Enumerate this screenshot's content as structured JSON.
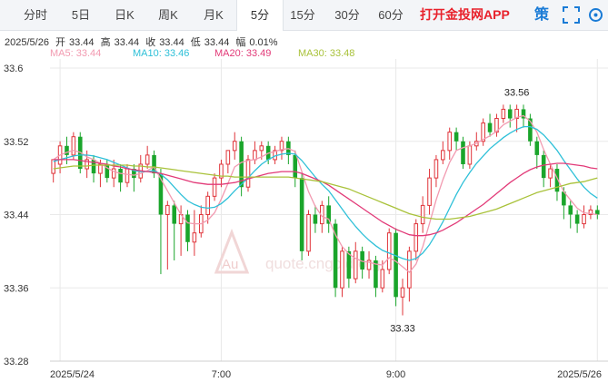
{
  "tabs": [
    {
      "label": "分时",
      "active": false
    },
    {
      "label": "5日",
      "active": false
    },
    {
      "label": "日K",
      "active": false
    },
    {
      "label": "周K",
      "active": false
    },
    {
      "label": "月K",
      "active": false
    },
    {
      "label": "5分",
      "active": true
    },
    {
      "label": "15分",
      "active": false
    },
    {
      "label": "30分",
      "active": false
    },
    {
      "label": "60分",
      "active": false
    }
  ],
  "app_title": "打开金投网APP",
  "strategy_label": "策",
  "icons": {
    "fullscreen": "fullscreen-icon",
    "settings": "settings-icon"
  },
  "quote": {
    "date": "2025/5/26",
    "open_label": "开",
    "open": "33.44",
    "high_label": "高",
    "high": "33.44",
    "close_label": "收",
    "close": "33.44",
    "low_label": "低",
    "low": "33.44",
    "change_label": "幅",
    "change": "0.01%"
  },
  "ma": {
    "ma5": "MA5: 33.44",
    "ma10": "MA10: 33.46",
    "ma20": "MA20: 33.49",
    "ma30": "MA30: 33.48"
  },
  "watermark": {
    "mark": "Au",
    "text": "quote.cngold.org"
  },
  "colors": {
    "up": "#e0343a",
    "down": "#1aa52b",
    "ma5": "#f29ab0",
    "ma10": "#2ec0d8",
    "ma20": "#e23a78",
    "ma30": "#a9c23a",
    "accent": "#e8212b",
    "link": "#1a7bd6",
    "grid": "#e9e9e9"
  },
  "chart_data": {
    "type": "candlestick",
    "ylim": [
      33.28,
      33.6
    ],
    "yticks": [
      "33.6",
      "33.52",
      "33.44",
      "33.36",
      "33.28"
    ],
    "xtick_labels": [
      "2025/5/24",
      "7:00",
      "9:00",
      "2025/5/26"
    ],
    "xtick_index": [
      1,
      25,
      51,
      81
    ],
    "annotations": [
      {
        "text": "33.56",
        "index": 69,
        "value": 33.56
      },
      {
        "text": "33.33",
        "index": 52,
        "value": 33.33
      }
    ],
    "candles": [
      [
        33.485,
        33.5,
        33.495,
        33.475
      ],
      [
        33.495,
        33.515,
        33.52,
        33.485
      ],
      [
        33.515,
        33.505,
        33.525,
        33.495
      ],
      [
        33.505,
        33.525,
        33.53,
        33.5
      ],
      [
        33.525,
        33.49,
        33.53,
        33.485
      ],
      [
        33.49,
        33.5,
        33.51,
        33.48
      ],
      [
        33.5,
        33.485,
        33.505,
        33.475
      ],
      [
        33.485,
        33.495,
        33.5,
        33.47
      ],
      [
        33.495,
        33.48,
        33.5,
        33.475
      ],
      [
        33.48,
        33.49,
        33.5,
        33.47
      ],
      [
        33.49,
        33.475,
        33.495,
        33.465
      ],
      [
        33.475,
        33.49,
        33.495,
        33.47
      ],
      [
        33.49,
        33.48,
        33.495,
        33.465
      ],
      [
        33.48,
        33.495,
        33.505,
        33.475
      ],
      [
        33.495,
        33.505,
        33.515,
        33.49
      ],
      [
        33.505,
        33.485,
        33.51,
        33.48
      ],
      [
        33.485,
        33.44,
        33.49,
        33.375
      ],
      [
        33.44,
        33.45,
        33.455,
        33.38
      ],
      [
        33.45,
        33.43,
        33.455,
        33.39
      ],
      [
        33.43,
        33.44,
        33.45,
        33.395
      ],
      [
        33.44,
        33.41,
        33.445,
        33.4
      ],
      [
        33.41,
        33.42,
        33.445,
        33.395
      ],
      [
        33.42,
        33.44,
        33.45,
        33.415
      ],
      [
        33.44,
        33.46,
        33.465,
        33.43
      ],
      [
        33.46,
        33.48,
        33.485,
        33.455
      ],
      [
        33.48,
        33.495,
        33.5,
        33.47
      ],
      [
        33.495,
        33.51,
        33.51,
        33.485
      ],
      [
        33.51,
        33.52,
        33.53,
        33.5
      ],
      [
        33.52,
        33.47,
        33.525,
        33.46
      ],
      [
        33.47,
        33.5,
        33.505,
        33.465
      ],
      [
        33.5,
        33.51,
        33.52,
        33.495
      ],
      [
        33.51,
        33.515,
        33.52,
        33.5
      ],
      [
        33.515,
        33.5,
        33.52,
        33.495
      ],
      [
        33.5,
        33.51,
        33.515,
        33.495
      ],
      [
        33.51,
        33.52,
        33.525,
        33.5
      ],
      [
        33.52,
        33.505,
        33.525,
        33.495
      ],
      [
        33.505,
        33.48,
        33.51,
        33.47
      ],
      [
        33.48,
        33.4,
        33.485,
        33.39
      ],
      [
        33.4,
        33.44,
        33.445,
        33.395
      ],
      [
        33.44,
        33.43,
        33.45,
        33.42
      ],
      [
        33.43,
        33.45,
        33.455,
        33.42
      ],
      [
        33.45,
        33.43,
        33.46,
        33.42
      ],
      [
        33.43,
        33.36,
        33.435,
        33.35
      ],
      [
        33.36,
        33.4,
        33.405,
        33.35
      ],
      [
        33.4,
        33.37,
        33.405,
        33.36
      ],
      [
        33.37,
        33.4,
        33.41,
        33.365
      ],
      [
        33.4,
        33.38,
        33.405,
        33.37
      ],
      [
        33.38,
        33.39,
        33.4,
        33.37
      ],
      [
        33.39,
        33.36,
        33.395,
        33.35
      ],
      [
        33.36,
        33.38,
        33.39,
        33.355
      ],
      [
        33.38,
        33.42,
        33.425,
        33.375
      ],
      [
        33.42,
        33.35,
        33.425,
        33.34
      ],
      [
        33.35,
        33.36,
        33.37,
        33.33
      ],
      [
        33.36,
        33.4,
        33.405,
        33.345
      ],
      [
        33.4,
        33.43,
        33.435,
        33.39
      ],
      [
        33.43,
        33.45,
        33.46,
        33.42
      ],
      [
        33.45,
        33.48,
        33.49,
        33.44
      ],
      [
        33.48,
        33.5,
        33.505,
        33.47
      ],
      [
        33.5,
        33.51,
        33.52,
        33.495
      ],
      [
        33.51,
        33.53,
        33.535,
        33.5
      ],
      [
        33.53,
        33.52,
        33.535,
        33.51
      ],
      [
        33.52,
        33.495,
        33.525,
        33.49
      ],
      [
        33.495,
        33.515,
        33.52,
        33.49
      ],
      [
        33.515,
        33.52,
        33.53,
        33.51
      ],
      [
        33.52,
        33.54,
        33.545,
        33.515
      ],
      [
        33.54,
        33.53,
        33.55,
        33.525
      ],
      [
        33.53,
        33.545,
        33.55,
        33.525
      ],
      [
        33.545,
        33.555,
        33.56,
        33.54
      ],
      [
        33.555,
        33.545,
        33.56,
        33.535
      ],
      [
        33.545,
        33.555,
        33.56,
        33.53
      ],
      [
        33.555,
        33.545,
        33.56,
        33.535
      ],
      [
        33.545,
        33.52,
        33.55,
        33.515
      ],
      [
        33.52,
        33.505,
        33.525,
        33.49
      ],
      [
        33.505,
        33.48,
        33.51,
        33.47
      ],
      [
        33.48,
        33.49,
        33.495,
        33.47
      ],
      [
        33.49,
        33.465,
        33.495,
        33.455
      ],
      [
        33.465,
        33.45,
        33.47,
        33.435
      ],
      [
        33.45,
        33.44,
        33.455,
        33.425
      ],
      [
        33.44,
        33.43,
        33.445,
        33.42
      ],
      [
        33.43,
        33.44,
        33.45,
        33.425
      ],
      [
        33.44,
        33.445,
        33.45,
        33.435
      ],
      [
        33.445,
        33.44,
        33.45,
        33.435
      ]
    ],
    "ma_series": [
      {
        "key": "ma5",
        "values": [
          33.5,
          33.505,
          33.508,
          33.51,
          33.508,
          33.503,
          33.5,
          33.496,
          33.491,
          33.487,
          33.485,
          33.484,
          33.483,
          33.485,
          33.488,
          33.492,
          33.479,
          33.466,
          33.453,
          33.44,
          33.431,
          33.43,
          33.43,
          33.434,
          33.442,
          33.457,
          33.474,
          33.492,
          33.497,
          33.499,
          33.5,
          33.503,
          33.507,
          33.509,
          33.511,
          33.512,
          33.509,
          33.487,
          33.465,
          33.449,
          33.438,
          33.435,
          33.418,
          33.405,
          33.397,
          33.392,
          33.389,
          33.388,
          33.386,
          33.385,
          33.393,
          33.389,
          33.383,
          33.377,
          33.386,
          33.405,
          33.43,
          33.456,
          33.478,
          33.497,
          33.51,
          33.513,
          33.515,
          33.518,
          33.522,
          33.526,
          33.531,
          33.538,
          33.542,
          33.546,
          33.548,
          33.542,
          33.53,
          33.511,
          33.495,
          33.48,
          33.465,
          33.456,
          33.447,
          33.442,
          33.441,
          33.44
        ]
      },
      {
        "key": "ma10",
        "values": [
          33.498,
          33.5,
          33.502,
          33.504,
          33.505,
          33.505,
          33.504,
          33.502,
          33.5,
          33.497,
          33.494,
          33.491,
          33.488,
          33.487,
          33.487,
          33.488,
          33.484,
          33.478,
          33.47,
          33.462,
          33.455,
          33.451,
          33.448,
          33.447,
          33.448,
          33.452,
          33.458,
          33.466,
          33.473,
          33.48,
          33.488,
          33.495,
          33.5,
          33.504,
          33.506,
          33.507,
          33.506,
          33.499,
          33.49,
          33.481,
          33.473,
          33.466,
          33.456,
          33.446,
          33.436,
          33.427,
          33.419,
          33.412,
          33.406,
          33.401,
          33.398,
          33.395,
          33.392,
          33.39,
          33.392,
          33.398,
          33.407,
          33.419,
          33.432,
          33.447,
          33.462,
          33.475,
          33.486,
          33.496,
          33.504,
          33.512,
          33.518,
          33.524,
          33.529,
          33.533,
          33.536,
          33.536,
          33.533,
          33.527,
          33.519,
          33.51,
          33.499,
          33.489,
          33.479,
          33.47,
          33.463,
          33.458
        ]
      },
      {
        "key": "ma20",
        "values": [
          33.5,
          33.5,
          33.5,
          33.5,
          33.499,
          33.498,
          33.497,
          33.496,
          33.495,
          33.493,
          33.492,
          33.49,
          33.489,
          33.488,
          33.487,
          33.486,
          33.485,
          33.483,
          33.481,
          33.479,
          33.477,
          33.475,
          33.474,
          33.473,
          33.473,
          33.473,
          33.474,
          33.475,
          33.477,
          33.479,
          33.481,
          33.483,
          33.485,
          33.486,
          33.487,
          33.487,
          33.487,
          33.485,
          33.482,
          33.479,
          33.476,
          33.472,
          33.467,
          33.462,
          33.457,
          33.452,
          33.447,
          33.442,
          33.437,
          33.432,
          33.428,
          33.424,
          33.421,
          33.418,
          33.417,
          33.417,
          33.418,
          33.42,
          33.423,
          33.427,
          33.431,
          33.436,
          33.441,
          33.446,
          33.451,
          33.457,
          33.463,
          33.469,
          33.475,
          33.48,
          33.485,
          33.489,
          33.492,
          33.494,
          33.495,
          33.496,
          33.496,
          33.495,
          33.494,
          33.493,
          33.491,
          33.49
        ]
      },
      {
        "key": "ma30",
        "values": [
          33.49,
          33.491,
          33.492,
          33.493,
          33.493,
          33.493,
          33.494,
          33.494,
          33.494,
          33.494,
          33.494,
          33.494,
          33.493,
          33.493,
          33.492,
          33.492,
          33.491,
          33.49,
          33.489,
          33.488,
          33.487,
          33.486,
          33.485,
          33.484,
          33.483,
          33.482,
          33.482,
          33.481,
          33.481,
          33.481,
          33.481,
          33.481,
          33.481,
          33.481,
          33.481,
          33.481,
          33.48,
          33.479,
          33.478,
          33.477,
          33.476,
          33.474,
          33.472,
          33.47,
          33.468,
          33.465,
          33.462,
          33.459,
          33.456,
          33.453,
          33.45,
          33.447,
          33.444,
          33.441,
          33.439,
          33.437,
          33.436,
          33.435,
          33.435,
          33.435,
          33.436,
          33.437,
          33.438,
          33.44,
          33.442,
          33.444,
          33.446,
          33.449,
          33.452,
          33.455,
          33.458,
          33.461,
          33.464,
          33.466,
          33.468,
          33.47,
          33.472,
          33.474,
          33.475,
          33.476,
          33.478,
          33.48
        ]
      }
    ]
  }
}
